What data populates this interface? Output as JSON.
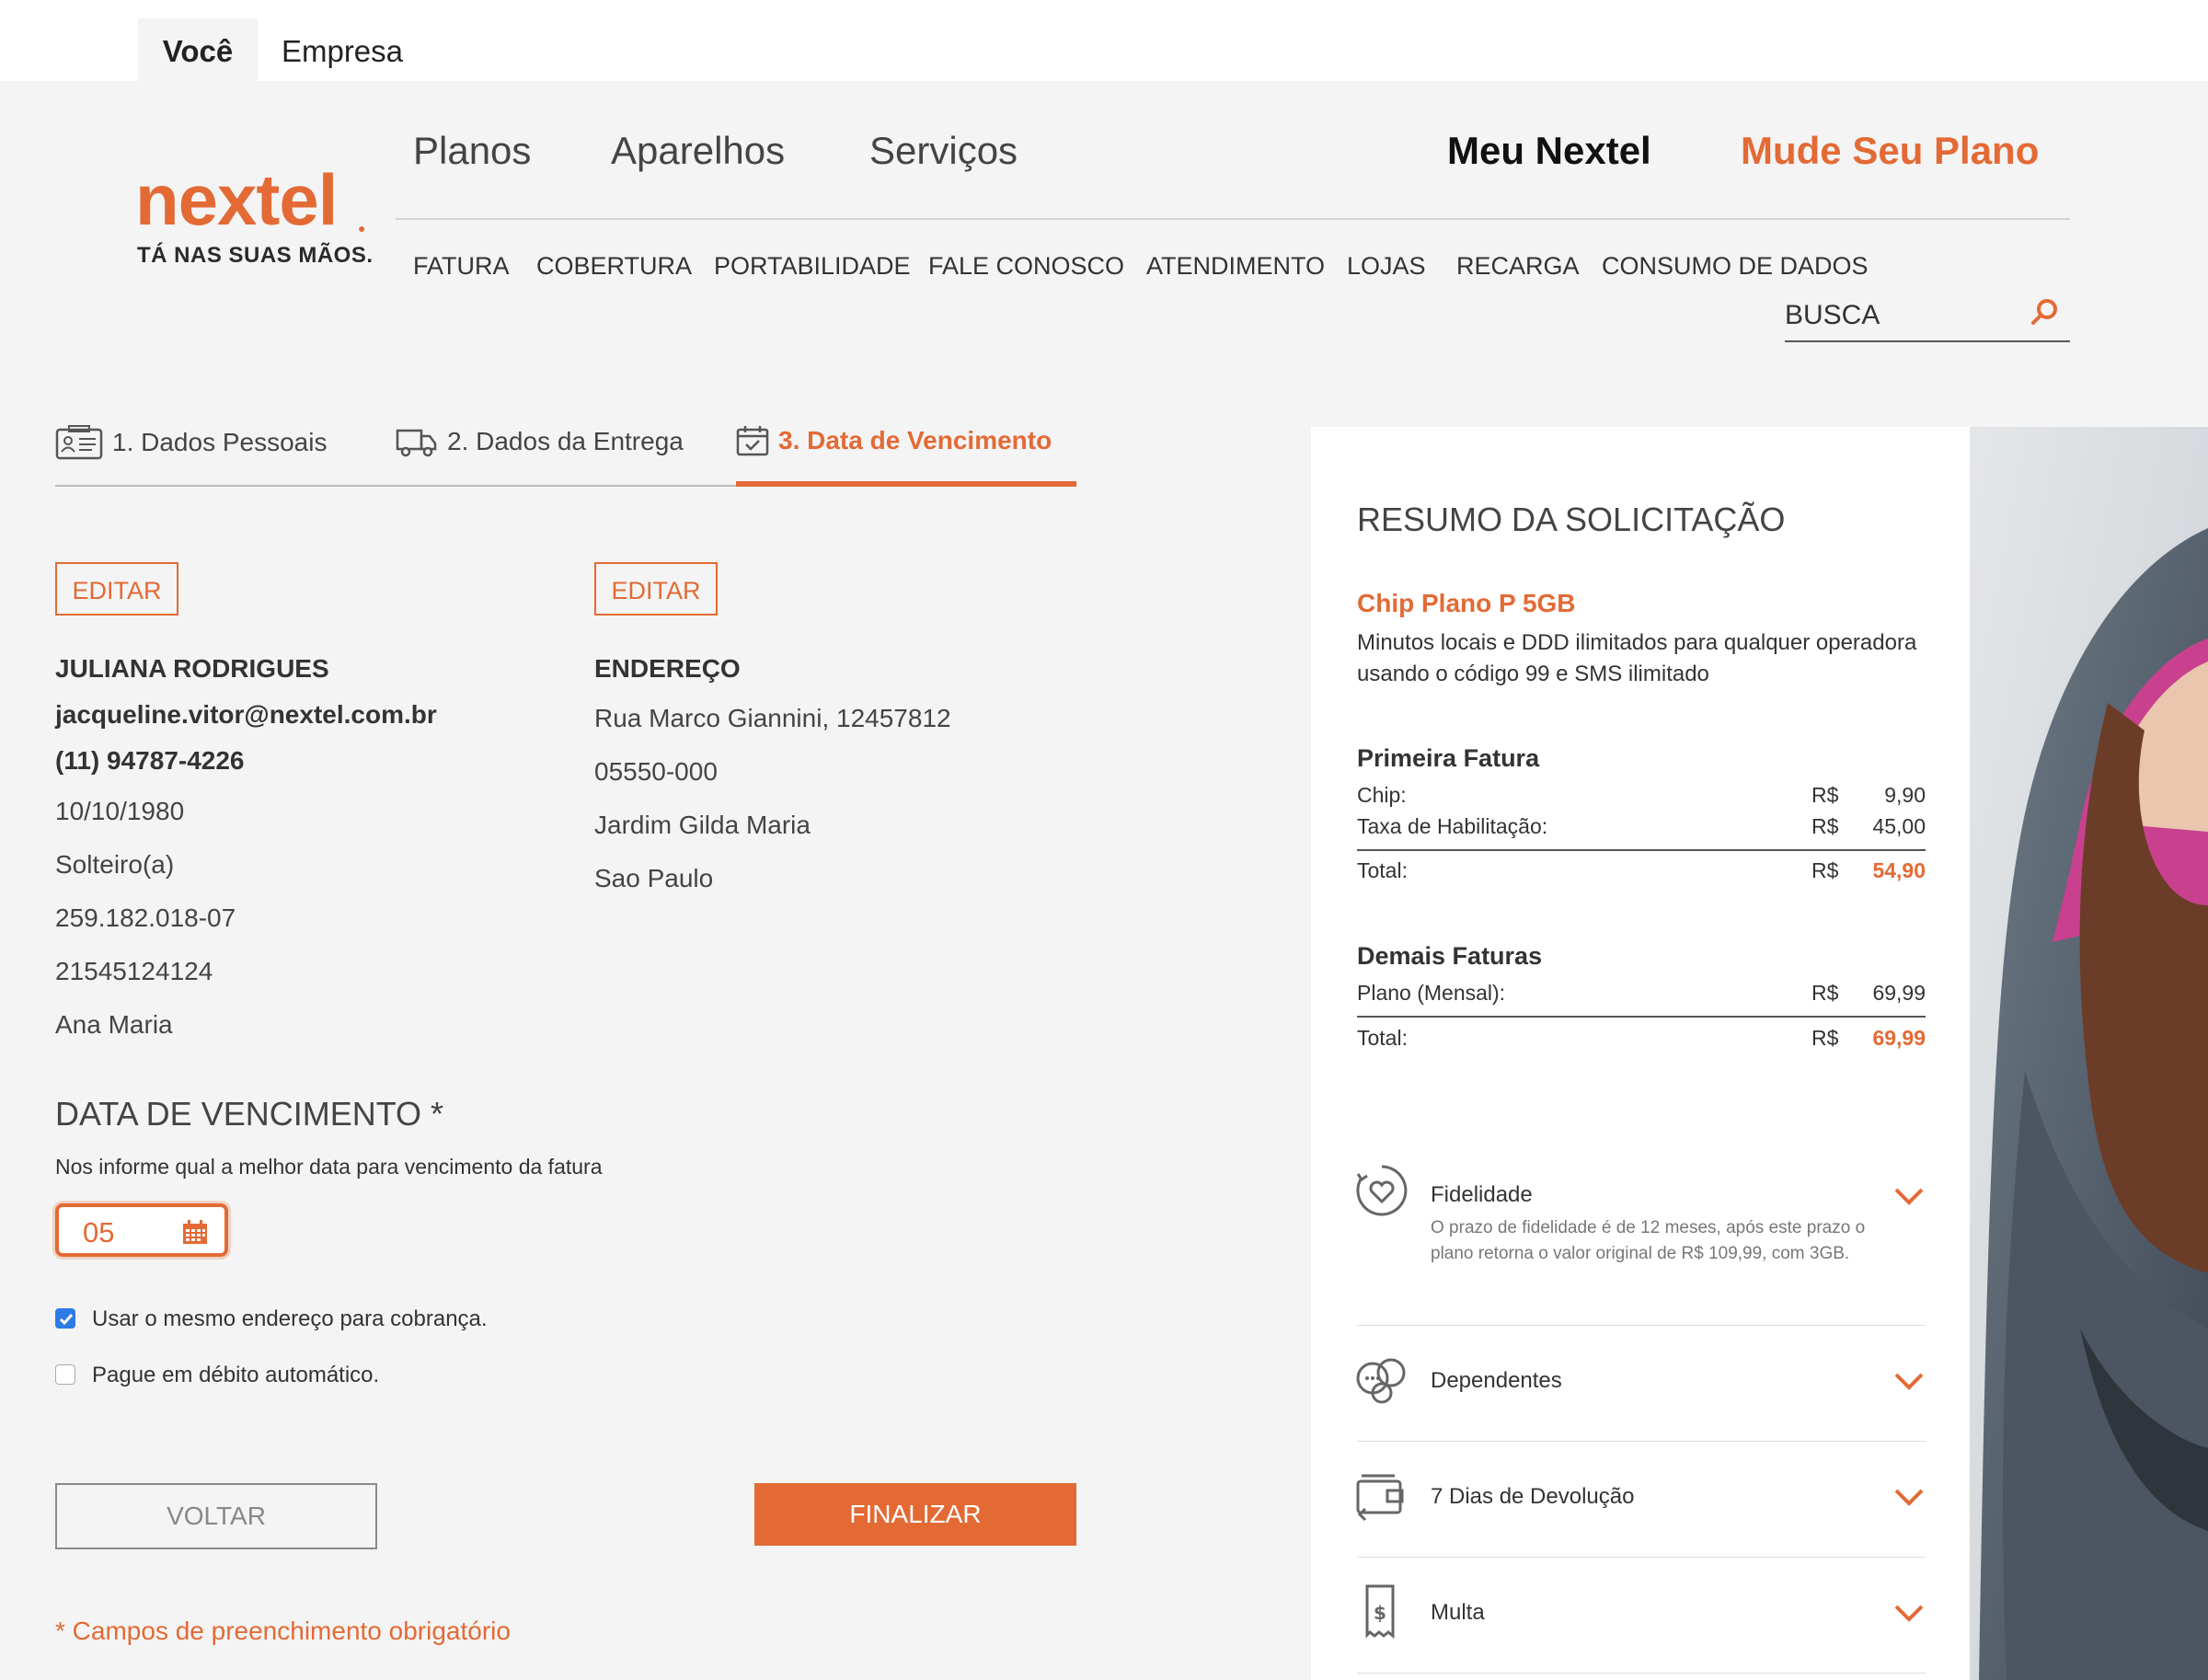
{
  "segment_tabs": {
    "voce": "Você",
    "empresa": "Empresa"
  },
  "logo": {
    "wordmark": "nextel",
    "slogan": "TÁ NAS SUAS MÃOS."
  },
  "main_nav": {
    "planos": "Planos",
    "aparelhos": "Aparelhos",
    "servicos": "Serviços",
    "meu_nextel": "Meu Nextel",
    "mude_seu_plano": "Mude Seu Plano"
  },
  "sub_nav": [
    "FATURA",
    "COBERTURA",
    "PORTABILIDADE",
    "FALE CONOSCO",
    "ATENDIMENTO",
    "LOJAS",
    "RECARGA",
    "CONSUMO DE DADOS"
  ],
  "search": {
    "label": "BUSCA"
  },
  "steps": {
    "step1": "1. Dados Pessoais",
    "step2": "2. Dados da Entrega",
    "step3": "3. Data de Vencimento",
    "active": 3
  },
  "personal": {
    "edit_label": "EDITAR",
    "name": "JULIANA RODRIGUES",
    "email": "jacqueline.vitor@nextel.com.br",
    "phone": "(11) 94787-4226",
    "birthdate": "10/10/1980",
    "marital_status": "Solteiro(a)",
    "cpf": "259.182.018-07",
    "rg": "21545124124",
    "mother_name": "Ana Maria"
  },
  "address": {
    "edit_label": "EDITAR",
    "heading": "ENDEREÇO",
    "street": "Rua Marco Giannini, 12457812",
    "zip": "05550-000",
    "district": "Jardim Gilda Maria",
    "city": "Sao Paulo"
  },
  "due_date": {
    "title": "DATA DE VENCIMENTO *",
    "hint": "Nos informe qual a melhor data para vencimento da fatura",
    "value": "05"
  },
  "options": {
    "same_address": {
      "label": "Usar o mesmo endereço para cobrança.",
      "checked": true
    },
    "auto_debit": {
      "label": "Pague em débito automático.",
      "checked": false
    }
  },
  "buttons": {
    "back": "VOLTAR",
    "finish": "FINALIZAR"
  },
  "required_note": "* Campos de preenchimento obrigatório",
  "summary": {
    "title": "RESUMO DA SOLICITAÇÃO",
    "plan_name": "Chip Plano P 5GB",
    "plan_desc": "Minutos locais e DDD ilimitados para qualquer operadora usando o código 99 e SMS ilimitado",
    "first_bill": {
      "heading": "Primeira Fatura",
      "rows": [
        {
          "label": "Chip:",
          "currency": "R$",
          "amount": "9,90"
        },
        {
          "label": "Taxa de Habilitação:",
          "currency": "R$",
          "amount": "45,00"
        }
      ],
      "total": {
        "label": "Total:",
        "currency": "R$",
        "amount": "54,90"
      }
    },
    "other_bills": {
      "heading": "Demais Faturas",
      "rows": [
        {
          "label": "Plano (Mensal):",
          "currency": "R$",
          "amount": "69,99"
        }
      ],
      "total": {
        "label": "Total:",
        "currency": "R$",
        "amount": "69,99"
      }
    },
    "accordions": [
      {
        "title": "Fidelidade",
        "icon": "heart-cycle-icon",
        "body": "O prazo de fidelidade é de 12 meses, após este prazo o plano retorna o valor original de R$ 109,99, com 3GB."
      },
      {
        "title": "Dependentes",
        "icon": "people-icon"
      },
      {
        "title": "7 Dias de Devolução",
        "icon": "wallet-return-icon"
      },
      {
        "title": "Multa",
        "icon": "receipt-dollar-icon"
      }
    ]
  },
  "colors": {
    "accent": "#e36a35",
    "background": "#f4f4f4",
    "panel": "#ffffff",
    "checkbox": "#2d7be5"
  }
}
